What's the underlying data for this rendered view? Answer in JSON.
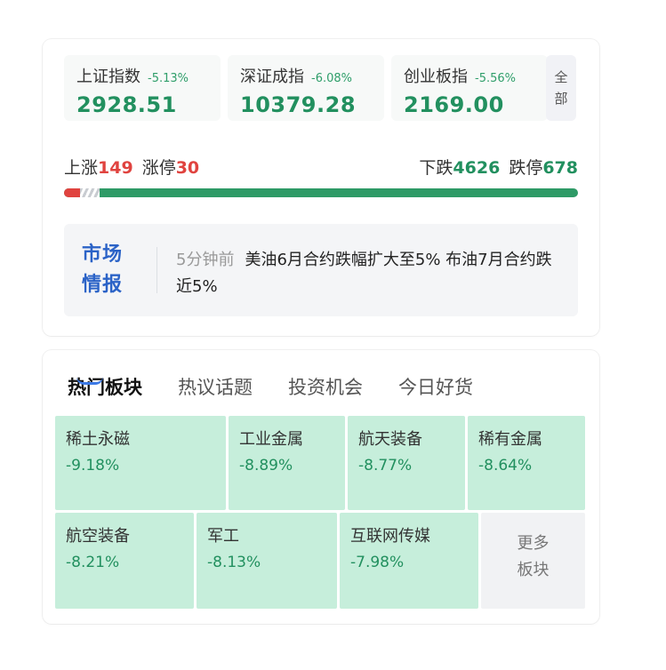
{
  "indices": [
    {
      "name": "上证指数",
      "pct": "-5.13%",
      "value": "2928.51"
    },
    {
      "name": "深证成指",
      "pct": "-6.08%",
      "value": "10379.28"
    },
    {
      "name": "创业板指",
      "pct": "-5.56%",
      "value": "2169.00"
    }
  ],
  "all_button": {
    "line1": "全",
    "line2": "部"
  },
  "breadth": {
    "up_label": "上涨",
    "up_count": "149",
    "limit_up_label": "涨停",
    "limit_up_count": "30",
    "down_label": "下跌",
    "down_count": "4626",
    "limit_down_label": "跌停",
    "limit_down_count": "678",
    "up_fraction": 0.031
  },
  "news": {
    "logo_line1": "市场",
    "logo_line2": "情报",
    "time": "5分钟前",
    "text": "美油6月合约跌幅扩大至5% 布油7月合约跌近5%"
  },
  "tabs": [
    "热门板块",
    "热议话题",
    "投资机会",
    "今日好货"
  ],
  "sectors": [
    {
      "name": "稀土永磁",
      "pct": "-9.18%"
    },
    {
      "name": "工业金属",
      "pct": "-8.89%"
    },
    {
      "name": "航天装备",
      "pct": "-8.77%"
    },
    {
      "name": "稀有金属",
      "pct": "-8.64%"
    },
    {
      "name": "航空装备",
      "pct": "-8.21%"
    },
    {
      "name": "军工",
      "pct": "-8.13%"
    },
    {
      "name": "互联网传媒",
      "pct": "-7.98%"
    }
  ],
  "more_button": {
    "line1": "更多",
    "line2": "板块"
  },
  "colors": {
    "up": "#e0433f",
    "down": "#22905f",
    "accent": "#3b79e6",
    "sector_bg": "#c6eedb"
  }
}
